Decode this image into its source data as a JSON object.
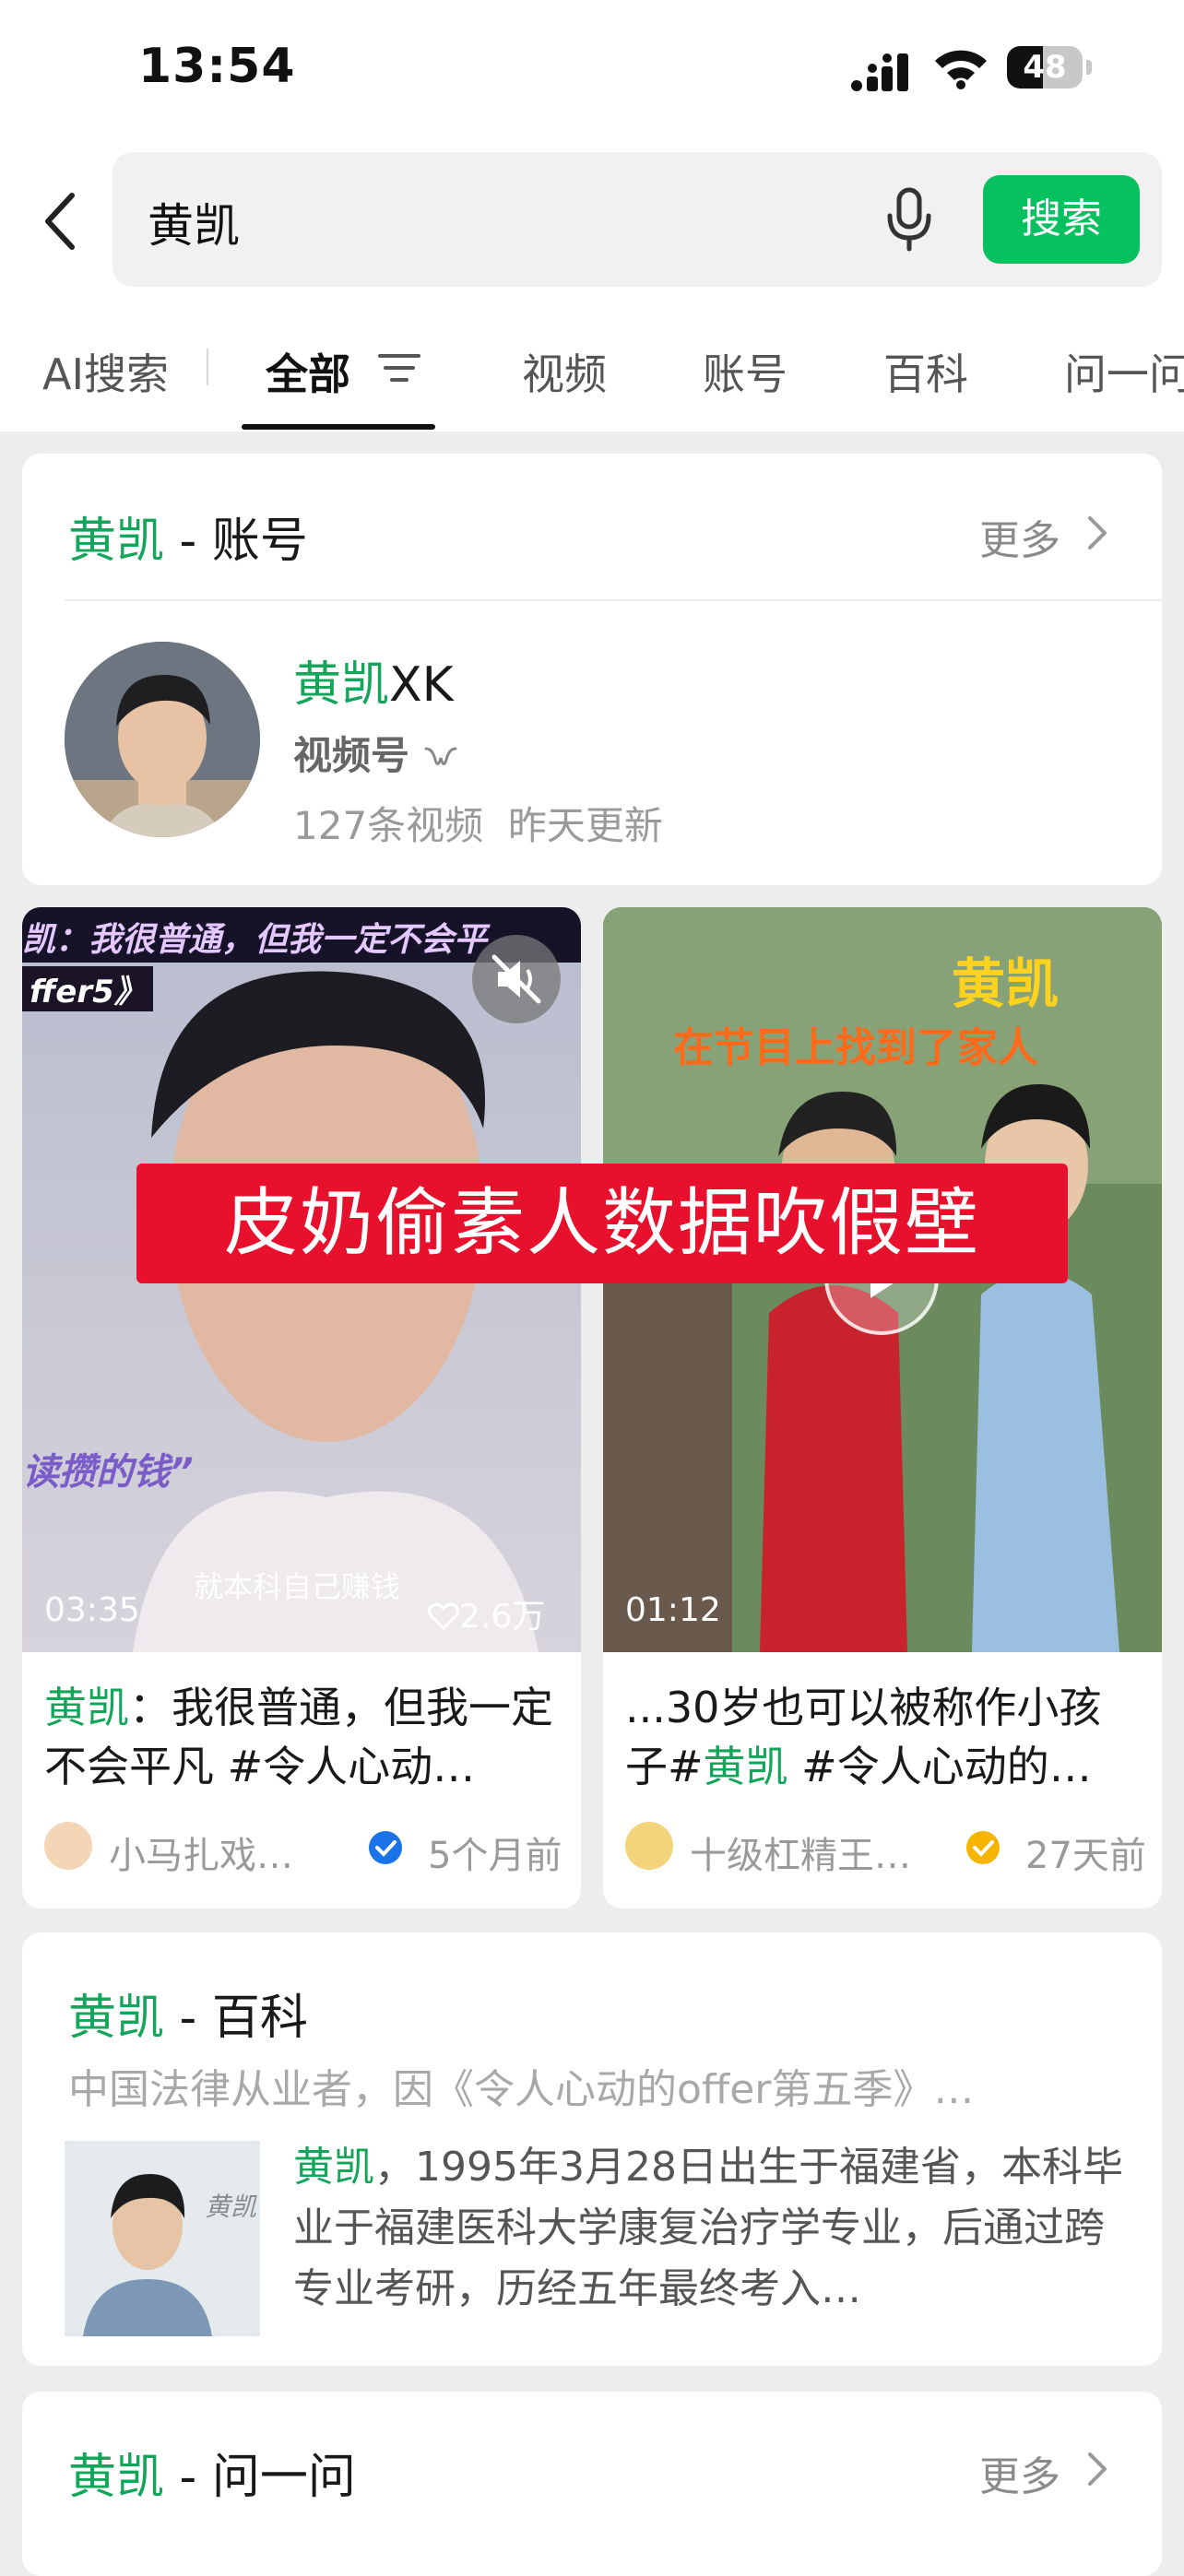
{
  "status_bar": {
    "time": "13:54",
    "battery": "48",
    "battery_level": 0.48
  },
  "search": {
    "query": "黄凯",
    "button_label": "搜索"
  },
  "tabs": {
    "ai": "AI搜索",
    "all": "全部",
    "video": "视频",
    "account": "账号",
    "baike": "百科",
    "ask": "问一问"
  },
  "account_section": {
    "keyword": "黄凯",
    "suffix": " - 账号",
    "more": "更多",
    "name_highlight": "黄凯",
    "name_rest": "XK",
    "type": "视频号",
    "stats": "127条视频  昨天更新"
  },
  "videos": [
    {
      "overlay_top": "凯：我很普通，但我一定不会平",
      "overlay_sub": "ffer5》",
      "overlay_left": "读攒的钱”",
      "caption": "就本科自己赚钱",
      "duration": "03:35",
      "likes": "2.6万",
      "title_highlight": "黄凯",
      "title_rest": "：我很普通，但我一定不会平凡 #令人心动…",
      "author": "小马扎戏…",
      "time_ago": "5个月前",
      "verify_color": "#1a73e8"
    },
    {
      "overlay_name": "黄凯",
      "overlay_sub": "在节目上找到了家人",
      "duration": "01:12",
      "title_pre": "...30岁也可以被称作小孩子#",
      "title_highlight": "黄凯",
      "title_post": " #令人心动的…",
      "author": "十级杠精王…",
      "time_ago": "27天前",
      "verify_color": "#f5b400"
    }
  ],
  "banner_text": "皮奶偷素人数据吹假壁",
  "baike_section": {
    "keyword": "黄凯",
    "suffix": " - 百科",
    "summary": "中国法律从业者，因《令人心动的offer第五季》…",
    "desc_highlight": "黄凯",
    "desc_rest": "，1995年3月28日出生于福建省，本科毕业于福建医科大学康复治疗学专业，后通过跨专业考研，历经五年最终考入…",
    "thumb_text": "黄凯"
  },
  "ask_section": {
    "keyword": "黄凯",
    "suffix": " - 问一问",
    "more": "更多"
  },
  "colors": {
    "accent": "#07c160",
    "highlight": "#13a65a",
    "banner": "#e8112d"
  }
}
